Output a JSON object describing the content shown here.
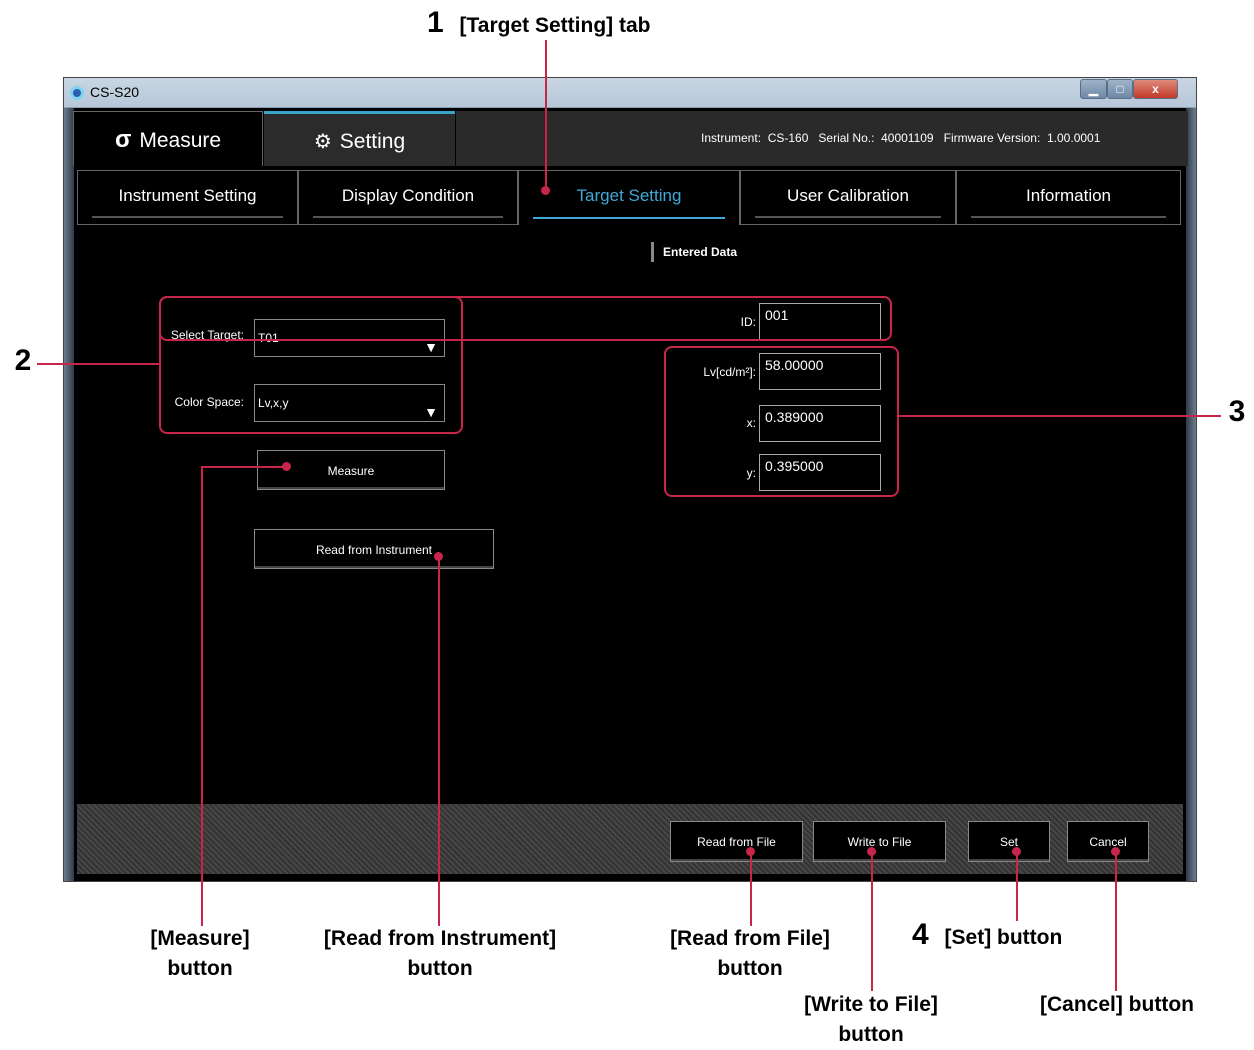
{
  "callouts": {
    "c1_num": "1",
    "c1_text": "[Target Setting] tab",
    "c2_num": "2",
    "c3_num": "3",
    "c4_num": "4",
    "c4_text": "[Set] button",
    "measure_btn": "[Measure]",
    "measure_btn2": "button",
    "read_instr": "[Read from Instrument]",
    "read_instr2": "button",
    "read_file": "[Read from File]",
    "read_file2": "button",
    "write_file": "[Write to File]",
    "write_file2": "button",
    "cancel": "[Cancel] button"
  },
  "window": {
    "title": "CS-S20",
    "min": "▁",
    "max": "□",
    "close": "x"
  },
  "main_tabs": {
    "measure": "Measure",
    "setting": "Setting"
  },
  "info": {
    "instrument_label": "Instrument:",
    "instrument": "CS-160",
    "serial_label": "Serial No.:",
    "serial": "40001109",
    "firmware_label": "Firmware Version:",
    "firmware": "1.00.0001"
  },
  "sub_tabs": [
    "Instrument Setting",
    "Display Condition",
    "Target Setting",
    "User Calibration",
    "Information"
  ],
  "section": "Entered Data",
  "form": {
    "select_target_label": "Select Target:",
    "select_target_value": "T01",
    "color_space_label": "Color Space:",
    "color_space_value": "Lv,x,y",
    "id_label": "ID:",
    "id_value": "001",
    "lv_label": "Lv[cd/m²]:",
    "lv_value": "58.00000",
    "x_label": "x:",
    "x_value": "0.389000",
    "y_label": "y:",
    "y_value": "0.395000"
  },
  "buttons": {
    "measure": "Measure",
    "read_instrument": "Read from Instrument",
    "read_file": "Read from File",
    "write_file": "Write to File",
    "set": "Set",
    "cancel": "Cancel"
  },
  "colors": {
    "accent": "#41a8d6",
    "highlight": "#c8254a"
  }
}
